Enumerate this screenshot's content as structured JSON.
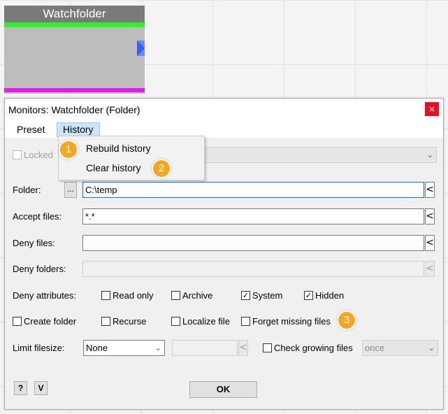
{
  "node": {
    "title": "Watchfolder"
  },
  "dialog": {
    "title": "Monitors: Watchfolder (Folder)",
    "close_glyph": "×",
    "menu": {
      "preset": "Preset",
      "history": "History"
    },
    "history_menu": {
      "rebuild": "Rebuild history",
      "clear": "Clear history"
    },
    "badges": [
      "1",
      "2",
      "3"
    ],
    "locked_label": "Locked",
    "folder_label": "Folder:",
    "folder_browse": "...",
    "folder_value": "C:\\temp",
    "accept_label": "Accept files:",
    "accept_value": "*.*",
    "deny_files_label": "Deny files:",
    "deny_files_value": "",
    "deny_folders_label": "Deny folders:",
    "deny_folders_value": "",
    "deny_attr_label": "Deny attributes:",
    "attr_readonly": "Read only",
    "attr_archive": "Archive",
    "attr_system": "System",
    "attr_hidden": "Hidden",
    "create_folder": "Create folder",
    "recurse": "Recurse",
    "localize_file": "Localize file",
    "forget_missing": "Forget missing files",
    "limit_label": "Limit filesize:",
    "limit_value": "None",
    "check_growing": "Check growing files",
    "growing_value": "once",
    "arrow_glyph": "<",
    "chevron_glyph": "⌄",
    "check_glyph": "✓",
    "help_btn": "?",
    "v_btn": "V",
    "ok_btn": "OK"
  },
  "colors": {
    "accent": "#0078d7",
    "badge": "#f5a623",
    "close": "#e81123",
    "node_green": "#30f030",
    "node_magenta": "#e020e0"
  }
}
